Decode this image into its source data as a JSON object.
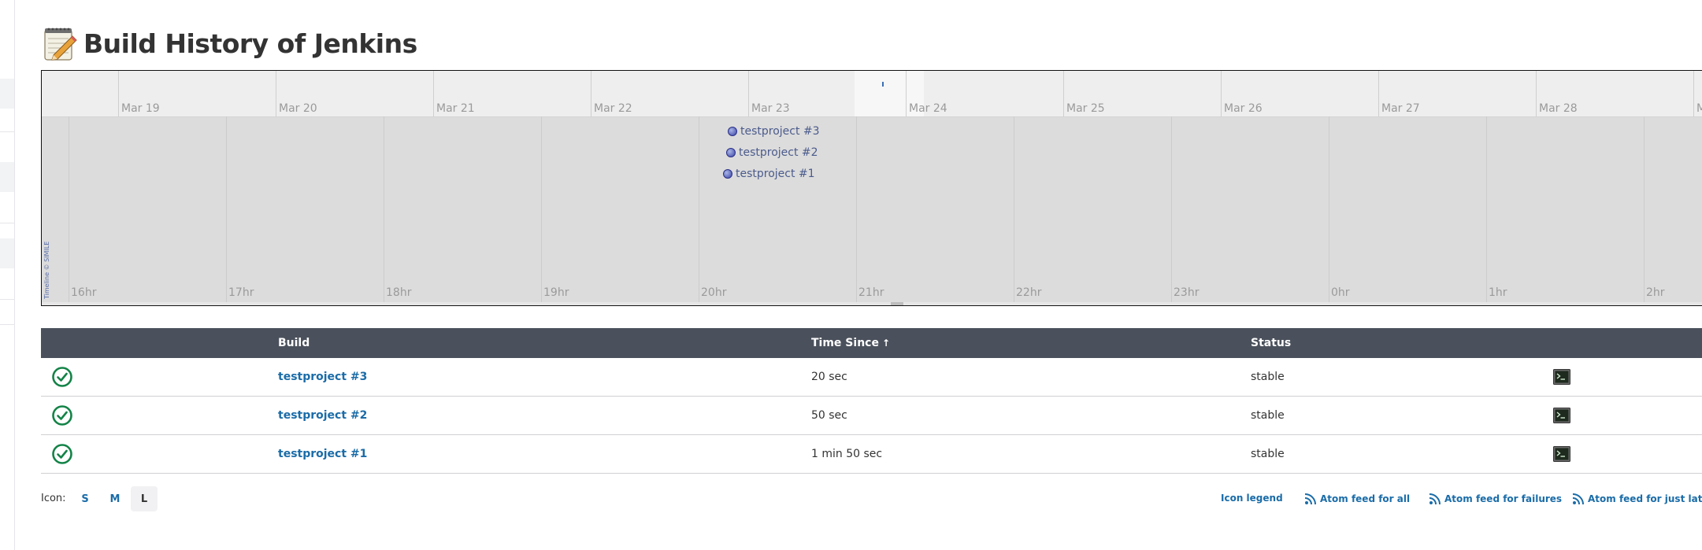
{
  "page": {
    "title": "Build History of Jenkins"
  },
  "timeline": {
    "credit": "Timeline © SIMILE",
    "days": [
      "Mar 19",
      "Mar 20",
      "Mar 21",
      "Mar 22",
      "Mar 23",
      "Mar 24",
      "Mar 25",
      "Mar 26",
      "Mar 27",
      "Mar 28",
      "M"
    ],
    "hours": [
      "16hr",
      "17hr",
      "18hr",
      "19hr",
      "20hr",
      "21hr",
      "22hr",
      "23hr",
      "0hr",
      "1hr",
      "2hr"
    ],
    "events": [
      {
        "label": "testproject #3"
      },
      {
        "label": "testproject #2"
      },
      {
        "label": "testproject #1"
      }
    ]
  },
  "table": {
    "headers": {
      "build": "Build",
      "time_since": "Time Since",
      "sort_arrow": "↑",
      "status": "Status"
    },
    "rows": [
      {
        "build": "testproject #3",
        "time_since": "20 sec",
        "status": "stable"
      },
      {
        "build": "testproject #2",
        "time_since": "50 sec",
        "status": "stable"
      },
      {
        "build": "testproject #1",
        "time_since": "1 min 50 sec",
        "status": "stable"
      }
    ]
  },
  "footer": {
    "icon_label": "Icon:",
    "sizes": [
      "S",
      "M",
      "L"
    ],
    "active_size": "L",
    "links": {
      "icon_legend": "Icon legend",
      "feed_all": "Atom feed for all",
      "feed_failures": "Atom feed for failures",
      "feed_latest": "Atom feed for just latest builds"
    }
  },
  "colors": {
    "table_header": "#4b515c",
    "link": "#1a6ca8",
    "success": "#138347"
  }
}
